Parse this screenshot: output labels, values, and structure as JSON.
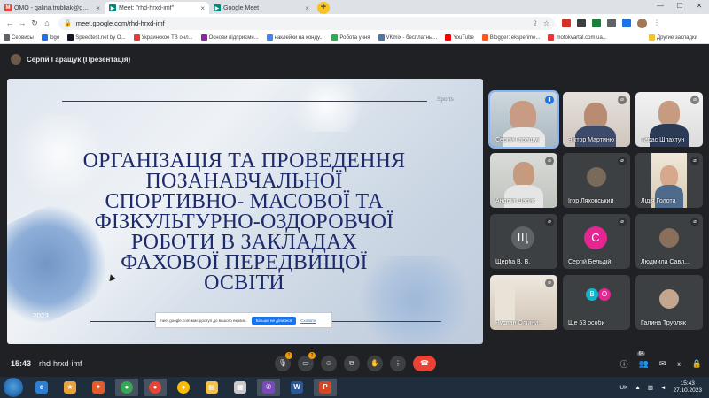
{
  "browser": {
    "tabs": [
      {
        "label": "ОМО - galina.trubliak@gmail.com",
        "icon": "gmail-icon",
        "color": "#ea4335",
        "active": false
      },
      {
        "label": "Meet: \"rhd-hrxd-imf\"",
        "icon": "meet-icon",
        "color": "#00897b",
        "active": true
      },
      {
        "label": "Google Meet",
        "icon": "meet-icon",
        "color": "#00897b",
        "active": false
      }
    ],
    "url": "meet.google.com/rhd-hrxd-imf",
    "bookmarks": [
      {
        "label": "Сервисы",
        "color": "#5f6368"
      },
      {
        "label": "logo",
        "color": "#1a73e8"
      },
      {
        "label": "Speedtest.net by O...",
        "color": "#141526"
      },
      {
        "label": "Украинское ТВ онл...",
        "color": "#e53935"
      },
      {
        "label": "Основи підприємн...",
        "color": "#8e24aa"
      },
      {
        "label": "наклейки на конду...",
        "color": "#4285f4"
      },
      {
        "label": "Робота учня",
        "color": "#34a853"
      },
      {
        "label": "VKmix - бесплатны...",
        "color": "#4a76a8"
      },
      {
        "label": "YouTube",
        "color": "#ff0000"
      },
      {
        "label": "Blogger: eksperime...",
        "color": "#ff5722"
      },
      {
        "label": "motokvartal.com.ua...",
        "color": "#e53935"
      }
    ],
    "other_bookmarks": "Другие закладки"
  },
  "meet": {
    "presenter": "Сергій Гаращук (Презентація)",
    "slide": {
      "title_lines": [
        "ОРГАНІЗАЦІЯ ТА ПРОВЕДЕННЯ",
        "ПОЗАНАВЧАЛЬНОЇ",
        "СПОРТИВНО- МАСОВОЇ ТА",
        "ФІЗКУЛЬТУРНО-ОЗДОРОВЧОЇ",
        "РОБОТИ В ЗАКЛАДАХ",
        "ФАХОВОЇ ПЕРЕДВИЩОЇ",
        "ОСВІТИ"
      ],
      "tag": "Sports",
      "year": "2023"
    },
    "share_notice": {
      "text": "meet.google.com має доступ до вашого екрана.",
      "button": "Більше не ділитися",
      "hide": "Сховати"
    },
    "participants": [
      {
        "name": "Сергій Гаращук",
        "kind": "camera",
        "speaking": true
      },
      {
        "name": "Віктор Мартиню",
        "kind": "camera",
        "speaking": false
      },
      {
        "name": "Тарас Шпахтун",
        "kind": "camera",
        "speaking": false
      },
      {
        "name": "Андрій Шарик",
        "kind": "camera",
        "speaking": false
      },
      {
        "name": "Ігор Ляховський",
        "kind": "photo",
        "speaking": false
      },
      {
        "name": "Лідія Голота",
        "kind": "camera",
        "speaking": false
      },
      {
        "name": "Щерба В. В.",
        "kind": "letter",
        "letter": "Щ",
        "color": "#5f6368",
        "speaking": false
      },
      {
        "name": "Сергій Бельдій",
        "kind": "letter",
        "letter": "С",
        "color": "#e52592",
        "speaking": false
      },
      {
        "name": "Людмила Савл...",
        "kind": "photo",
        "speaking": false
      },
      {
        "name": "Руслан Олійни...",
        "kind": "camera",
        "speaking": false
      },
      {
        "name": "Ще 53 особи",
        "kind": "more",
        "letters": [
          "В",
          "О"
        ],
        "colors": [
          "#12b5cb",
          "#e52592"
        ],
        "speaking": false
      },
      {
        "name": "Галина Трубляк",
        "kind": "photo",
        "speaking": false
      }
    ],
    "clock": "15:43",
    "code": "rhd-hrxd-imf",
    "mic_badge": "1",
    "cam_badge": "2",
    "people_count": "64"
  },
  "taskbar": {
    "lang": "UK",
    "time": "15:43",
    "date": "27.10.2023"
  }
}
